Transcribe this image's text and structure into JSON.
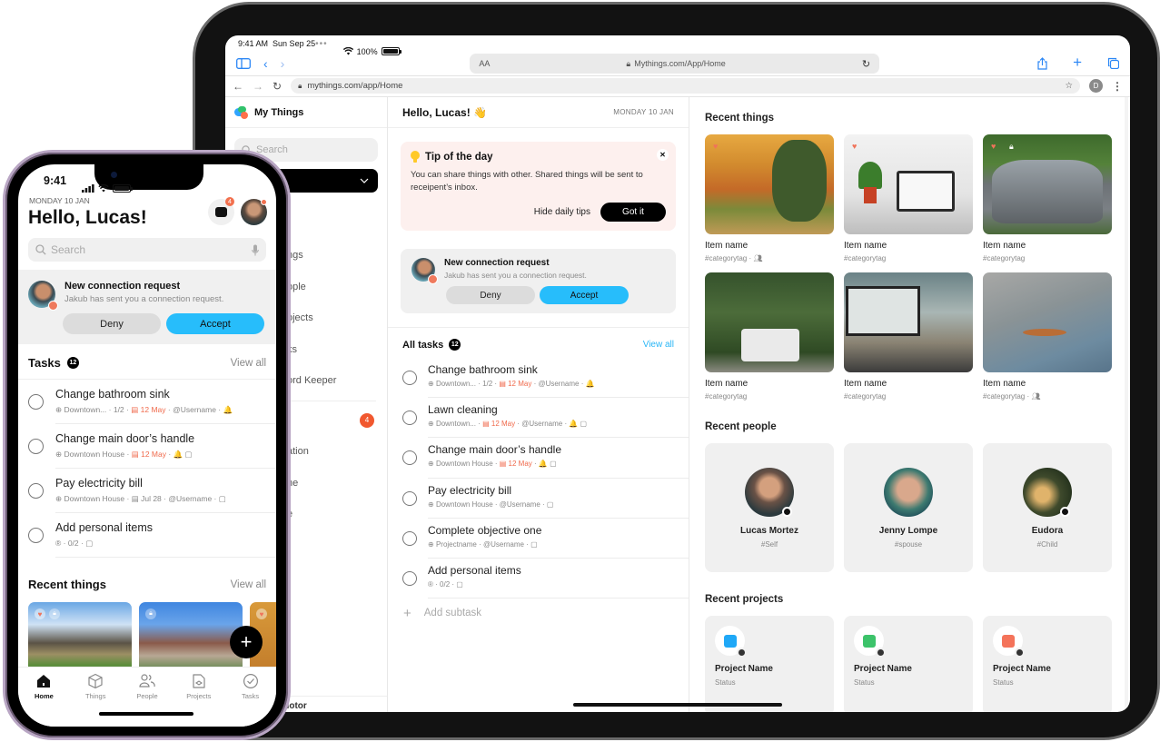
{
  "ipad": {
    "status": {
      "time": "9:41 AM",
      "date": "Sun Sep 25",
      "battery": "100%",
      "battery_level": 1.0
    },
    "safari": {
      "url": "Mythings.com/App/Home",
      "text_size": "AA"
    },
    "chrome": {
      "url": "mythings.com/app/Home",
      "profile_initial": "D"
    },
    "sidebar": {
      "brand": "My Things",
      "search_placeholder": "Search",
      "items": [
        {
          "label": "ngs"
        },
        {
          "label": "ople"
        },
        {
          "label": "ojects"
        },
        {
          "label": "ks"
        },
        {
          "label": "ord Keeper"
        }
      ],
      "items2": [
        {
          "label": "",
          "badge": "4"
        },
        {
          "label": "ation"
        },
        {
          "label": "ne"
        },
        {
          "label": "e"
        }
      ],
      "footer": "Motor"
    },
    "middle": {
      "greeting": "Hello, Lucas! 👋",
      "date": "MONDAY 10 JAN",
      "tip": {
        "title": "Tip of the day",
        "body": "You can share things with other. Shared things will be sent to receipent’s inbox.",
        "hide_label": "Hide daily tips",
        "got_it_label": "Got it"
      },
      "connection": {
        "title": "New connection request",
        "subtitle": "Jakub has sent you a connection request.",
        "deny_label": "Deny",
        "accept_label": "Accept"
      },
      "tasks": {
        "title": "All tasks",
        "count": "12",
        "view_all": "View all",
        "items": [
          {
            "title": "Change bathroom sink",
            "location": "Downtown...",
            "progress": "1/2",
            "date": "12 May",
            "user": "@Username",
            "extras": "🔔"
          },
          {
            "title": "Lawn cleaning",
            "location": "Downtown...",
            "progress": "",
            "date": "12 May",
            "user": "@Username",
            "extras": "🔔 ▢"
          },
          {
            "title": "Change main door’s handle",
            "location": "Downtown House",
            "progress": "",
            "date": "12 May",
            "user": "",
            "extras": "🔔 ▢"
          },
          {
            "title": "Pay electricity bill",
            "location": "Downtown House",
            "progress": "",
            "date": "",
            "user": "@Username",
            "extras": "▢"
          },
          {
            "title": "Complete objective one",
            "location": "Projectname",
            "progress": "",
            "date": "",
            "user": "@Username",
            "extras": "▢"
          },
          {
            "title": "Add personal items",
            "location": "",
            "progress": "0/2",
            "date": "",
            "user": "",
            "extras": "▢"
          }
        ],
        "add_subtask": "Add subtask"
      }
    },
    "right": {
      "recent_things": {
        "title": "Recent things",
        "items": [
          {
            "name": "Item name",
            "tag": "#categorytag",
            "shared": true,
            "favorite": true,
            "locked": false
          },
          {
            "name": "Item name",
            "tag": "#categorytag",
            "shared": false,
            "favorite": true,
            "locked": false
          },
          {
            "name": "Item name",
            "tag": "#categorytag",
            "shared": false,
            "favorite": true,
            "locked": true
          },
          {
            "name": "Item name",
            "tag": "#categorytag",
            "shared": false,
            "favorite": false,
            "locked": false
          },
          {
            "name": "Item name",
            "tag": "#categorytag",
            "shared": false,
            "favorite": false,
            "locked": false
          },
          {
            "name": "Item name",
            "tag": "#categorytag",
            "shared": true,
            "favorite": false,
            "locked": false
          }
        ]
      },
      "recent_people": {
        "title": "Recent people",
        "items": [
          {
            "name": "Lucas Mortez",
            "tag": "#Self"
          },
          {
            "name": "Jenny Lompe",
            "tag": "#spouse"
          },
          {
            "name": "Eudora",
            "tag": "#Child"
          }
        ]
      },
      "recent_projects": {
        "title": "Recent projects",
        "items": [
          {
            "name": "Project Name",
            "status": "Status",
            "color": "#1fa8f7"
          },
          {
            "name": "Project Name",
            "status": "Status",
            "color": "#3cc36a"
          },
          {
            "name": "Project Name",
            "status": "Status",
            "color": "#f4735a"
          }
        ]
      }
    }
  },
  "iphone": {
    "status": {
      "time": "9:41"
    },
    "date": "MONDAY 10 JAN",
    "greeting": "Hello, Lucas!",
    "inbox_count": "4",
    "search_placeholder": "Search",
    "connection": {
      "title": "New connection request",
      "subtitle": "Jakub has sent you a connection request.",
      "deny_label": "Deny",
      "accept_label": "Accept"
    },
    "tasks": {
      "title": "Tasks",
      "count": "12",
      "view_all": "View all",
      "items": [
        {
          "title": "Change bathroom sink",
          "location": "Downtown...",
          "progress": "1/2",
          "date": "12 May",
          "date_overdue": true,
          "user": "@Username",
          "extras": "🔔"
        },
        {
          "title": "Change main door’s handle",
          "location": "Downtown House",
          "progress": "",
          "date": "12 May",
          "date_overdue": true,
          "user": "",
          "extras": "🔔 ▢"
        },
        {
          "title": "Pay electricity bill",
          "location": "Downtown House",
          "progress": "",
          "date": "Jul 28",
          "date_overdue": false,
          "user": "@Username",
          "extras": "▢"
        },
        {
          "title": "Add personal items",
          "location": "",
          "progress": "0/2",
          "date": "",
          "date_overdue": false,
          "user": "",
          "extras": "▢"
        }
      ]
    },
    "recent_things": {
      "title": "Recent things",
      "view_all": "View all"
    },
    "fab_label": "+",
    "tabs": [
      {
        "label": "Home",
        "icon": "home-icon",
        "active": true
      },
      {
        "label": "Things",
        "icon": "cube-icon",
        "active": false
      },
      {
        "label": "People",
        "icon": "people-icon",
        "active": false
      },
      {
        "label": "Projects",
        "icon": "projects-icon",
        "active": false
      },
      {
        "label": "Tasks",
        "icon": "check-circle-icon",
        "active": false
      }
    ]
  },
  "colors": {
    "accent": "#27bdfb",
    "alert": "#f1582f",
    "tip_bg": "#fdf0ee",
    "card_bg": "#f0f0f0"
  }
}
